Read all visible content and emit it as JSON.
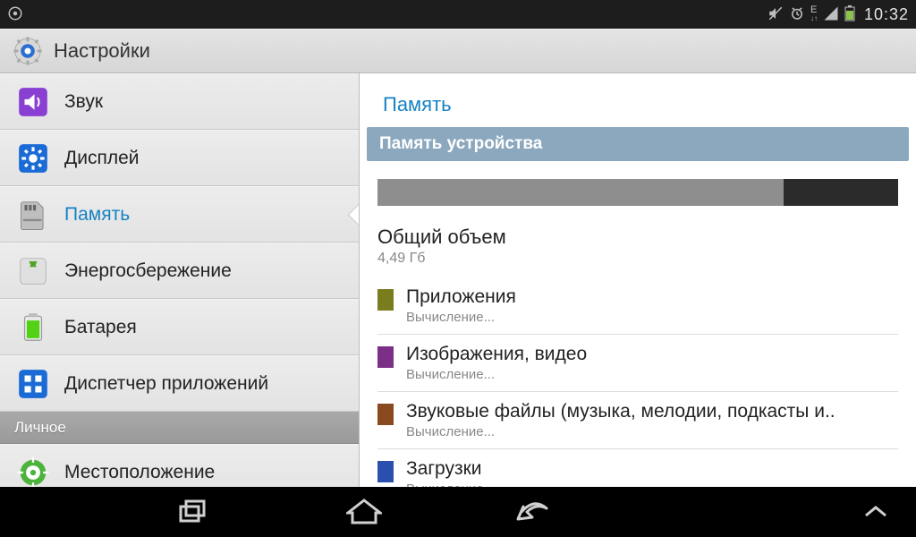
{
  "status": {
    "time": "10:32",
    "network_label": "E"
  },
  "app": {
    "title": "Настройки"
  },
  "sidebar": {
    "items": [
      {
        "id": "sound",
        "label": "Звук",
        "icon": "speaker-icon",
        "color": "#8a3fd3"
      },
      {
        "id": "display",
        "label": "Дисплей",
        "icon": "gear-square-icon",
        "color": "#1a6bd6"
      },
      {
        "id": "storage",
        "label": "Память",
        "icon": "sd-card-icon",
        "color": "#6c6c6c",
        "active": true
      },
      {
        "id": "power",
        "label": "Энергосбережение",
        "icon": "recycle-icon",
        "color": "#52a428"
      },
      {
        "id": "battery",
        "label": "Батарея",
        "icon": "battery-icon",
        "color": "#52d214"
      },
      {
        "id": "apps",
        "label": "Диспетчер приложений",
        "icon": "apps-grid-icon",
        "color": "#1a6bd6"
      }
    ],
    "category2_label": "Личное",
    "items2": [
      {
        "id": "location",
        "label": "Местоположение",
        "icon": "location-icon",
        "color": "#4cb33b"
      }
    ]
  },
  "main": {
    "title": "Память",
    "section_header": "Память устройства",
    "used_pct": 78,
    "total": {
      "label": "Общий объем",
      "value": "4,49 Гб"
    },
    "categories": [
      {
        "label": "Приложения",
        "sub": "Вычисление...",
        "color": "#7a7d1d"
      },
      {
        "label": "Изображения, видео",
        "sub": "Вычисление...",
        "color": "#7b2f87"
      },
      {
        "label": "Звуковые файлы (музыка, мелодии, подкасты и..",
        "sub": "Вычисление...",
        "color": "#8a4a1f"
      },
      {
        "label": "Загрузки",
        "sub": "Вычисление...",
        "color": "#2b4fae"
      }
    ]
  }
}
